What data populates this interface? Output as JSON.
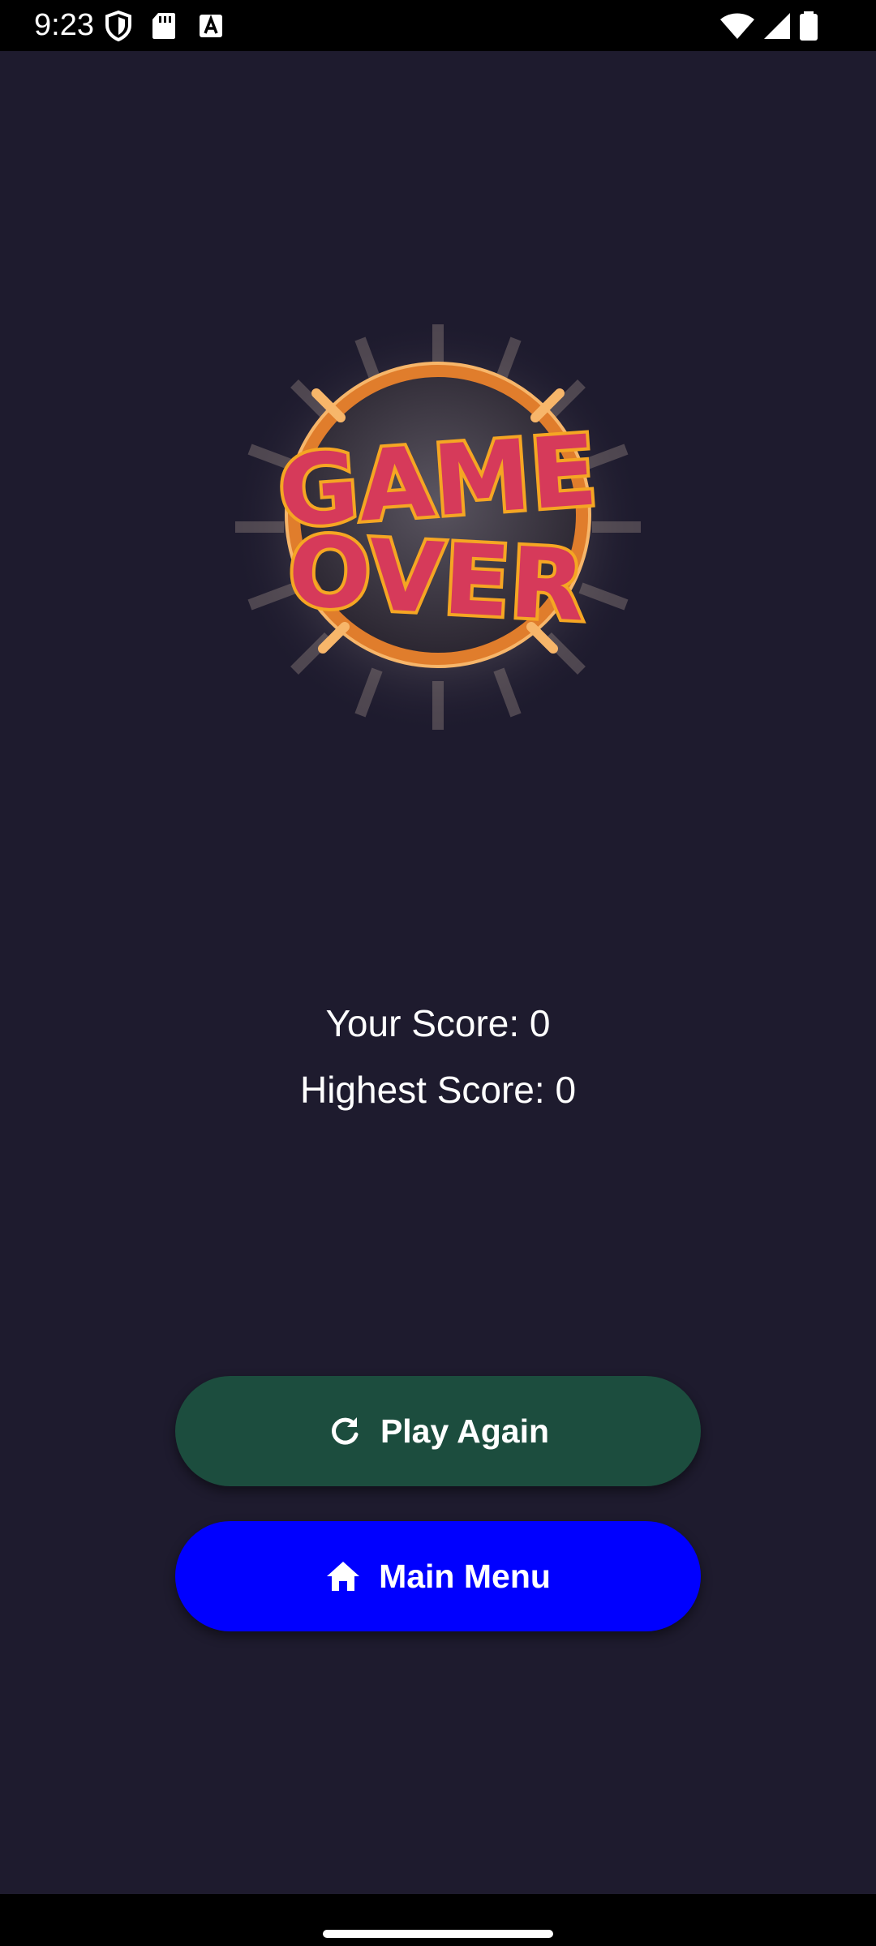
{
  "status_bar": {
    "time": "9:23",
    "icons_left": [
      "shield-icon",
      "sd-card-icon",
      "font-a-icon"
    ],
    "icons_right": [
      "wifi-icon",
      "signal-icon",
      "battery-icon"
    ]
  },
  "logo": {
    "text": "GAME OVER",
    "line1": "GAME",
    "line2": "OVER",
    "colors": {
      "fill": "#d63a5a",
      "outline": "#f5a623",
      "ring": "#e07d2c"
    }
  },
  "scores": {
    "current_text": "Your Score: 0",
    "highest_text": "Highest Score: 0"
  },
  "buttons": {
    "play_again": {
      "label": "Play Again",
      "icon": "refresh-icon",
      "color": "#1c4d3e"
    },
    "main_menu": {
      "label": "Main Menu",
      "icon": "home-icon",
      "color": "#0000ff"
    }
  },
  "theme": {
    "background": "#1e1b2e"
  }
}
